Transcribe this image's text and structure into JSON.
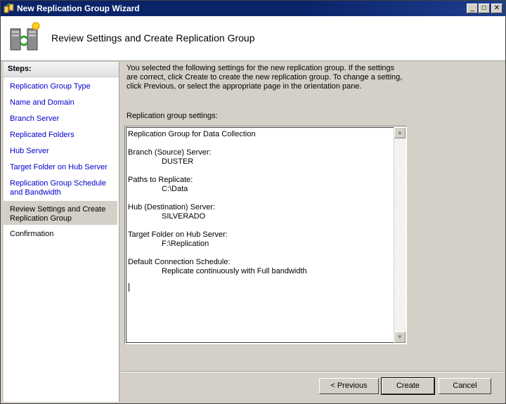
{
  "window": {
    "title": "New Replication Group Wizard",
    "controls": {
      "minimize": "_",
      "maximize": "□",
      "close": "✕"
    }
  },
  "header": {
    "title": "Review Settings and Create Replication Group",
    "icon": "replication-server-icon"
  },
  "sidebar": {
    "heading": "Steps:",
    "items": [
      {
        "label": "Replication Group Type",
        "state": "link"
      },
      {
        "label": "Name and Domain",
        "state": "link"
      },
      {
        "label": "Branch Server",
        "state": "link"
      },
      {
        "label": "Replicated Folders",
        "state": "link"
      },
      {
        "label": "Hub Server",
        "state": "link"
      },
      {
        "label": "Target Folder on Hub Server",
        "state": "link"
      },
      {
        "label": "Replication Group Schedule and Bandwidth",
        "state": "link"
      },
      {
        "label": "Review Settings and Create Replication Group",
        "state": "active"
      },
      {
        "label": "Confirmation",
        "state": "plain"
      }
    ]
  },
  "main": {
    "description": "You selected the following settings for the new replication group. If the settings are correct, click Create to create the new replication group. To change a setting, click Previous, or select the appropriate page in the orientation pane.",
    "settings_label": "Replication group settings:",
    "settings": {
      "title": "Replication Group for Data Collection",
      "branch_label": "Branch (Source) Server:",
      "branch_value": "DUSTER",
      "paths_label": "Paths to Replicate:",
      "paths_value": "C:\\Data",
      "hub_label": "Hub (Destination) Server:",
      "hub_value": "SILVERADO",
      "target_label": "Target Folder on Hub Server:",
      "target_value": "F:\\Replication",
      "schedule_label": "Default Connection Schedule:",
      "schedule_value": "Replicate continuously with Full bandwidth"
    }
  },
  "buttons": {
    "previous": "< Previous",
    "create": "Create",
    "cancel": "Cancel"
  },
  "colors": {
    "link": "#0000cc",
    "titlebar": "#0a246a",
    "face": "#d4d0c8"
  }
}
